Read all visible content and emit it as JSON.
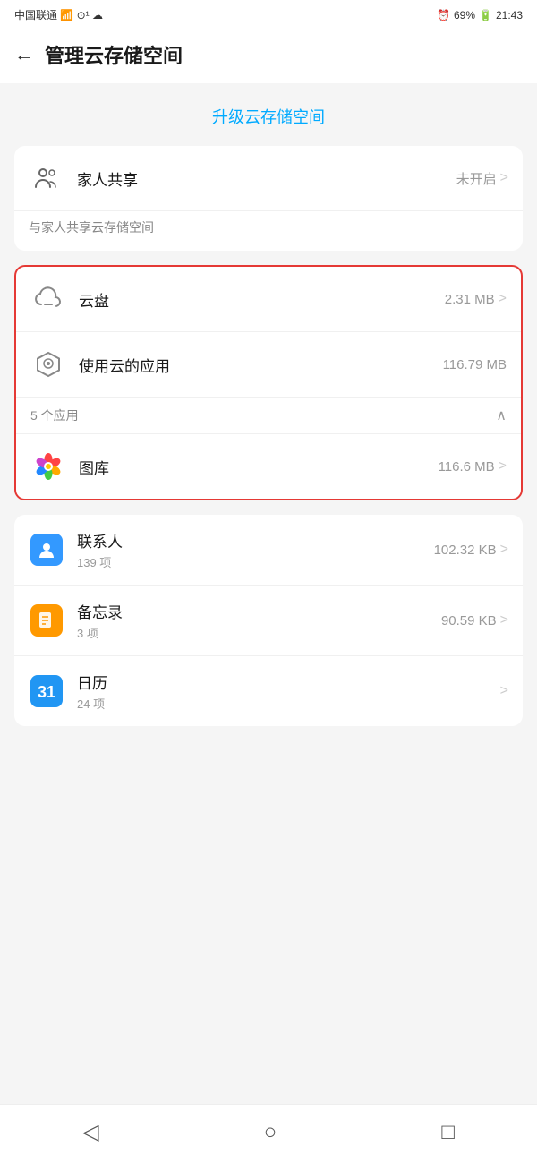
{
  "statusBar": {
    "carrier": "中国联通",
    "signal": "📶",
    "time": "21:43",
    "battery": "69%"
  },
  "header": {
    "backLabel": "←",
    "title": "管理云存储空间"
  },
  "upgrade": {
    "label": "升级云存储空间"
  },
  "familyCard": {
    "icon": "person-group-icon",
    "label": "家人共享",
    "status": "未开启",
    "chevron": ">",
    "description": "与家人共享云存储空间"
  },
  "redSection": {
    "cloudDisk": {
      "icon": "cloud-icon",
      "label": "云盘",
      "value": "2.31 MB",
      "chevron": ">"
    },
    "cloudApps": {
      "icon": "cloud-hex-icon",
      "label": "使用云的应用",
      "value": "116.79 MB",
      "expandLabel": "5 个应用",
      "expandIcon": "∧"
    },
    "gallery": {
      "icon": "gallery-icon",
      "label": "图库",
      "value": "116.6 MB",
      "chevron": ">"
    }
  },
  "appList": [
    {
      "icon": "contacts-icon",
      "label": "联系人",
      "sublabel": "139 项",
      "value": "102.32 KB",
      "chevron": ">"
    },
    {
      "icon": "notes-icon",
      "label": "备忘录",
      "sublabel": "3 项",
      "value": "90.59 KB",
      "chevron": ">"
    },
    {
      "icon": "calendar-icon",
      "label": "日历",
      "sublabel": "24 项",
      "value": "",
      "chevron": ">"
    }
  ],
  "bottomNav": {
    "back": "◁",
    "home": "○",
    "recent": "□"
  }
}
